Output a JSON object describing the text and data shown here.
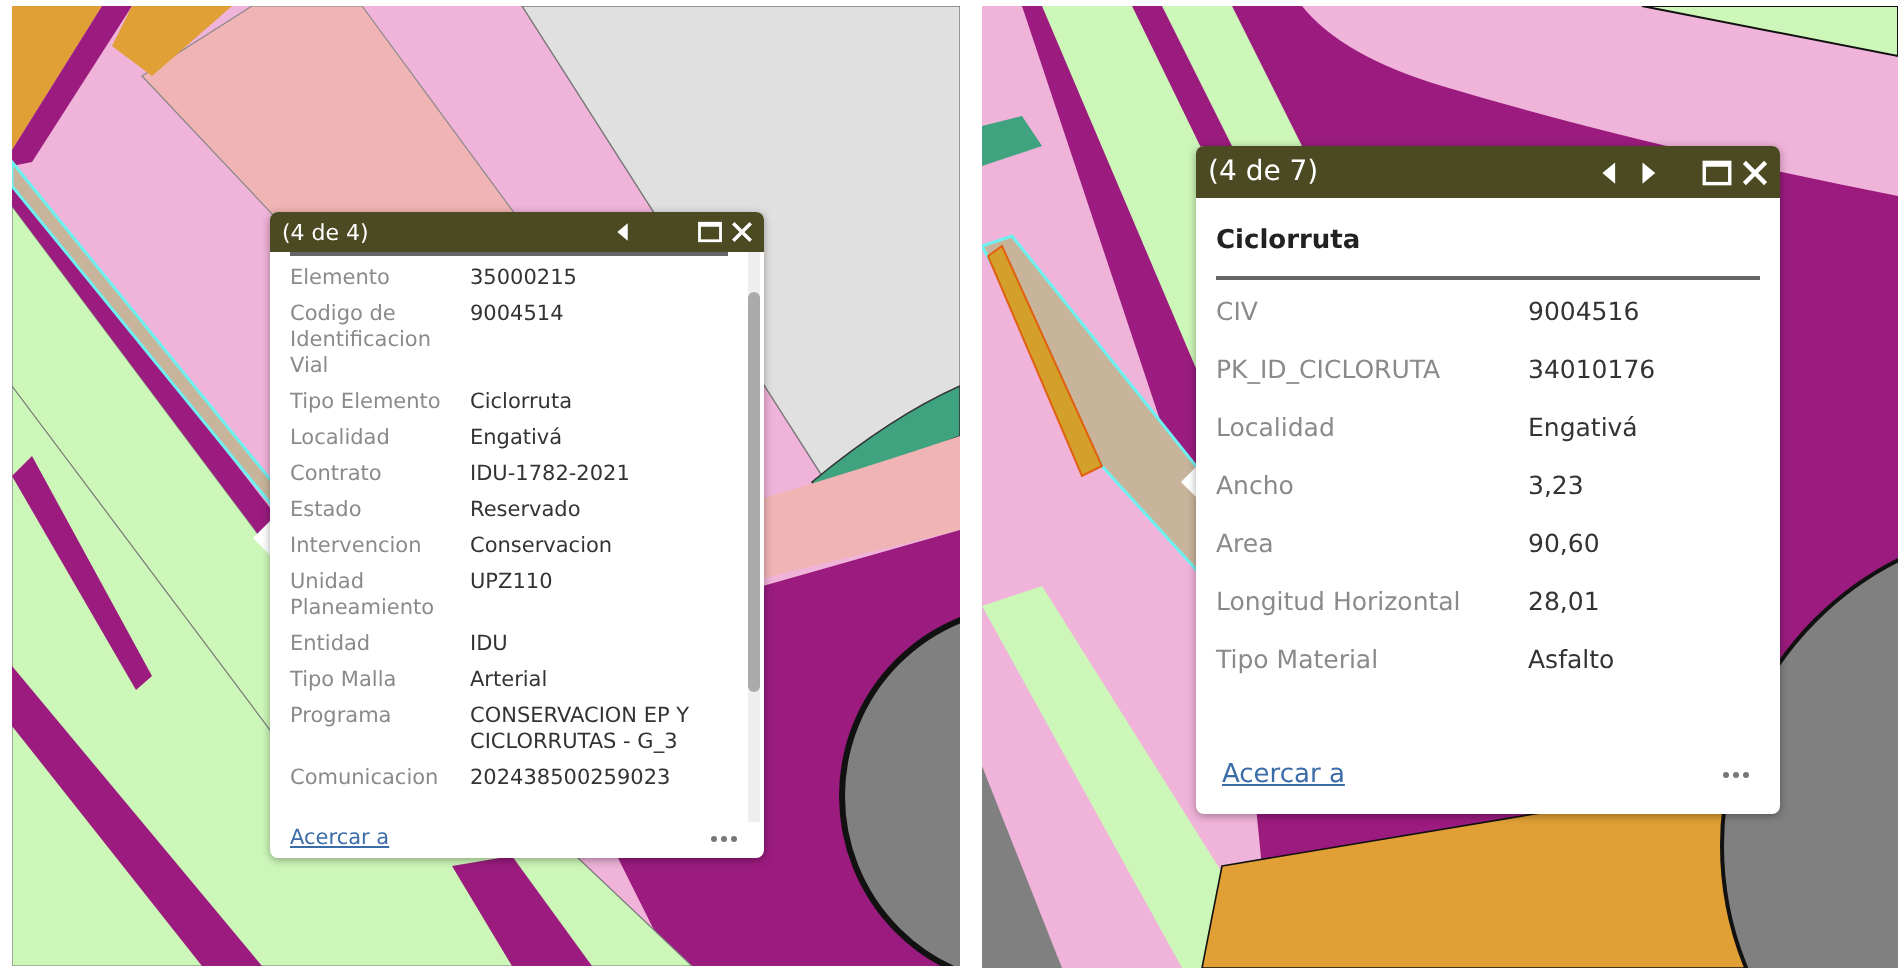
{
  "panels": [
    {
      "popup": {
        "counter": "(4 de 4)",
        "controls": [
          {
            "kind": "previous"
          },
          {
            "kind": "maximize"
          },
          {
            "kind": "close"
          }
        ],
        "scrollable": true,
        "fields": [
          {
            "label": "Elemento",
            "value": "35000215"
          },
          {
            "label": "Codigo de Identificacion Vial",
            "value": "9004514"
          },
          {
            "label": "Tipo Elemento",
            "value": "Ciclorruta"
          },
          {
            "label": "Localidad",
            "value": "Engativá"
          },
          {
            "label": "Contrato",
            "value": "IDU-1782-2021"
          },
          {
            "label": "Estado",
            "value": "Reservado"
          },
          {
            "label": "Intervencion",
            "value": "Conservacion"
          },
          {
            "label": "Unidad Planeamiento",
            "value": "UPZ110"
          },
          {
            "label": "Entidad",
            "value": "IDU"
          },
          {
            "label": "Tipo Malla",
            "value": "Arterial"
          },
          {
            "label": "Programa",
            "value": "CONSERVACION EP Y CICLORRUTAS - G_3"
          },
          {
            "label": "Comunicacion",
            "value": "202438500259023"
          }
        ],
        "link": "Acercar a"
      }
    },
    {
      "popup": {
        "counter": "(4 de 7)",
        "controls": [
          {
            "kind": "previous"
          },
          {
            "kind": "next"
          },
          {
            "kind": "maximize"
          },
          {
            "kind": "close"
          }
        ],
        "scrollable": false,
        "title": "Ciclorruta",
        "fields": [
          {
            "label": "CIV",
            "value": "9004516"
          },
          {
            "label": "PK_ID_CICLORUTA",
            "value": "34010176"
          },
          {
            "label": "Localidad",
            "value": "Engativá"
          },
          {
            "label": "Ancho",
            "value": "3,23"
          },
          {
            "label": "Area",
            "value": "90,60"
          },
          {
            "label": "Longitud Horizontal",
            "value": "28,01"
          },
          {
            "label": "Tipo Material",
            "value": "Asfalto"
          }
        ],
        "link": "Acercar a"
      }
    }
  ]
}
